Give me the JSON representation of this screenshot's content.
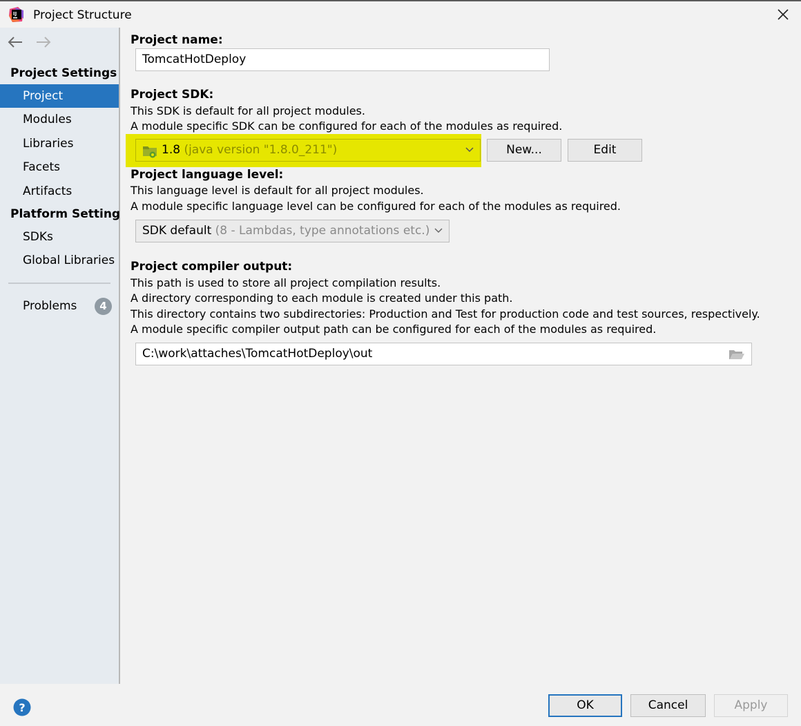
{
  "window": {
    "title": "Project Structure"
  },
  "sidebar": {
    "project_settings_header": "Project Settings",
    "project_items": [
      {
        "label": "Project",
        "selected": true
      },
      {
        "label": "Modules"
      },
      {
        "label": "Libraries"
      },
      {
        "label": "Facets"
      },
      {
        "label": "Artifacts"
      }
    ],
    "platform_settings_header": "Platform Settings",
    "platform_items": [
      {
        "label": "SDKs"
      },
      {
        "label": "Global Libraries"
      }
    ],
    "problems": {
      "label": "Problems",
      "count": "4"
    }
  },
  "main": {
    "project_name": {
      "label": "Project name:",
      "value": "TomcatHotDeploy"
    },
    "project_sdk": {
      "label": "Project SDK:",
      "desc1": "This SDK is default for all project modules.",
      "desc2": "A module specific SDK can be configured for each of the modules as required.",
      "selected_version": "1.8",
      "selected_detail": "(java version \"1.8.0_211\")",
      "new_button": "New...",
      "edit_button": "Edit"
    },
    "language_level": {
      "label": "Project language level:",
      "desc1": "This language level is default for all project modules.",
      "desc2": "A module specific language level can be configured for each of the modules as required.",
      "selected": "SDK default",
      "selected_detail": "(8 - Lambdas, type annotations etc.)"
    },
    "compiler_output": {
      "label": "Project compiler output:",
      "desc1": "This path is used to store all project compilation results.",
      "desc2": "A directory corresponding to each module is created under this path.",
      "desc3": "This directory contains two subdirectories: Production and Test for production code and test sources, respectively.",
      "desc4": "A module specific compiler output path can be configured for each of the modules as required.",
      "path": "C:\\work\\attaches\\TomcatHotDeploy\\out"
    }
  },
  "footer": {
    "ok": "OK",
    "cancel": "Cancel",
    "apply": "Apply"
  },
  "colors": {
    "selection": "#2675bf",
    "highlight": "#e6e600",
    "sidebar_bg": "#e6ebf0"
  }
}
